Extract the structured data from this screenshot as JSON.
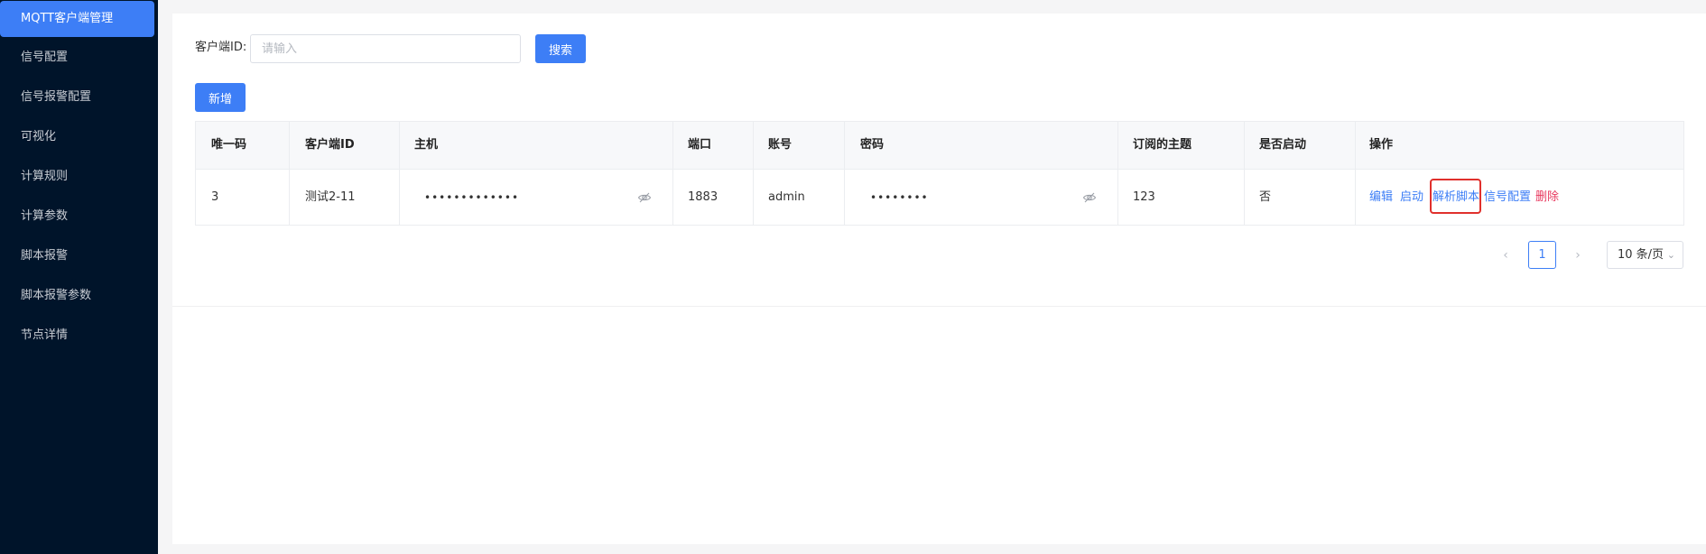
{
  "sidebar": {
    "items": [
      {
        "label": "MQTT客户端管理",
        "active": true
      },
      {
        "label": "信号配置"
      },
      {
        "label": "信号报警配置"
      },
      {
        "label": "可视化"
      },
      {
        "label": "计算规则"
      },
      {
        "label": "计算参数"
      },
      {
        "label": "脚本报警"
      },
      {
        "label": "脚本报警参数"
      },
      {
        "label": "节点详情"
      }
    ]
  },
  "search": {
    "label": "客户端ID:",
    "placeholder": "请输入",
    "button": "搜索"
  },
  "toolbar": {
    "add_label": "新增"
  },
  "table": {
    "columns": [
      "唯一码",
      "客户端ID",
      "主机",
      "端口",
      "账号",
      "密码",
      "订阅的主题",
      "是否启动",
      "操作"
    ],
    "rows": [
      {
        "id": "3",
        "client_id": "测试2-11",
        "host": "•••••••••••••",
        "port": "1883",
        "account": "admin",
        "password": "••••••••",
        "topic": "123",
        "enabled": "否",
        "actions": [
          "编辑",
          "启动",
          "解析脚本",
          "信号配置",
          "删除"
        ]
      }
    ]
  },
  "pagination": {
    "current_page": "1",
    "prev": "‹",
    "next": "›",
    "page_size": "10 条/页"
  },
  "colors": {
    "sidebar_bg": "#00142a",
    "accent": "#3d7ef6",
    "danger": "#e8385e",
    "highlight": "#e0302c"
  }
}
